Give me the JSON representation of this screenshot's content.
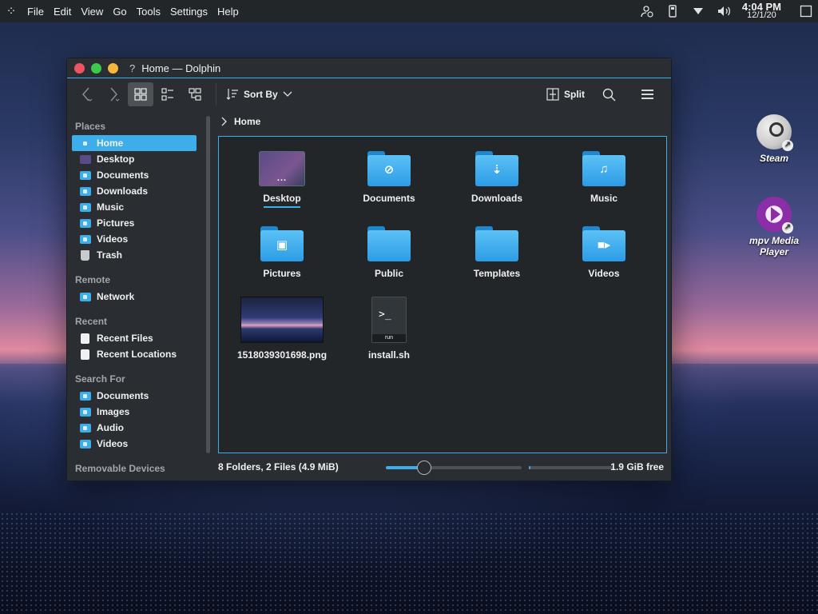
{
  "menubar": {
    "items": [
      "File",
      "Edit",
      "View",
      "Go",
      "Tools",
      "Settings",
      "Help"
    ]
  },
  "tray": {
    "time": "4:04 PM",
    "date": "12/1/20"
  },
  "window": {
    "help_mark": "?",
    "title": "Home — Dolphin"
  },
  "toolbar": {
    "sort_label": "Sort By",
    "split_label": "Split"
  },
  "sidebar": {
    "places_heading": "Places",
    "places": [
      {
        "label": "Home",
        "icon": "home-folder-icon",
        "selected": true
      },
      {
        "label": "Desktop",
        "icon": "desktop-icon"
      },
      {
        "label": "Documents",
        "icon": "documents-folder-icon"
      },
      {
        "label": "Downloads",
        "icon": "downloads-folder-icon"
      },
      {
        "label": "Music",
        "icon": "music-folder-icon"
      },
      {
        "label": "Pictures",
        "icon": "pictures-folder-icon"
      },
      {
        "label": "Videos",
        "icon": "videos-folder-icon"
      },
      {
        "label": "Trash",
        "icon": "trash-icon"
      }
    ],
    "remote_heading": "Remote",
    "remote": [
      {
        "label": "Network",
        "icon": "network-folder-icon"
      }
    ],
    "recent_heading": "Recent",
    "recent": [
      {
        "label": "Recent Files",
        "icon": "recent-files-icon"
      },
      {
        "label": "Recent Locations",
        "icon": "recent-locations-icon"
      }
    ],
    "search_heading": "Search For",
    "search": [
      {
        "label": "Documents",
        "icon": "documents-folder-icon"
      },
      {
        "label": "Images",
        "icon": "images-folder-icon"
      },
      {
        "label": "Audio",
        "icon": "audio-folder-icon"
      },
      {
        "label": "Videos",
        "icon": "videos-folder-icon"
      }
    ],
    "removable_heading": "Removable Devices"
  },
  "breadcrumb": {
    "current": "Home"
  },
  "files": {
    "row1": [
      "Desktop",
      "Documents",
      "Downloads",
      "Music"
    ],
    "row2": [
      "Pictures",
      "Public",
      "Templates",
      "Videos"
    ],
    "row3": [
      "1518039301698.png",
      "install.sh"
    ],
    "desktop_glyph": "...",
    "script_glyph": ">_",
    "script_badge": "run"
  },
  "status": {
    "summary": "8 Folders, 2 Files (4.9 MiB)",
    "free": "1.9 GiB free",
    "zoom_fraction": 0.28,
    "used_fraction": 0.02
  },
  "desktop_icons": {
    "steam": "Steam",
    "mpv": "mpv Media Player"
  },
  "colors": {
    "accent": "#3daee9",
    "window_bg": "#2a2e32",
    "view_bg": "#232629",
    "close": "#ed5565",
    "minimize": "#f6b73c",
    "maximize": "#3bc94e"
  }
}
